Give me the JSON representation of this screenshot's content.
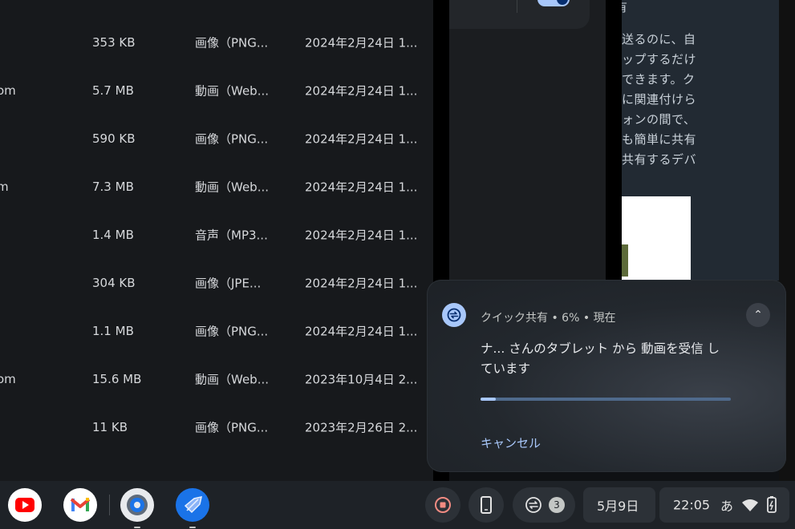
{
  "files": {
    "rows": [
      {
        "name": "",
        "size": "353 KB",
        "type": "画像（PNG...",
        "date": "2024年2月24日 1..."
      },
      {
        "name": "om",
        "size": "5.7 MB",
        "type": "動画（Web...",
        "date": "2024年2月24日 1..."
      },
      {
        "name": "",
        "size": "590 KB",
        "type": "画像（PNG...",
        "date": "2024年2月24日 1..."
      },
      {
        "name": "m",
        "size": "7.3 MB",
        "type": "動画（Web...",
        "date": "2024年2月24日 1..."
      },
      {
        "name": "",
        "size": "1.4 MB",
        "type": "音声（MP3...",
        "date": "2024年2月24日 1..."
      },
      {
        "name": "",
        "size": "304 KB",
        "type": "画像（JPE...",
        "date": "2024年2月24日 1..."
      },
      {
        "name": "",
        "size": "1.1 MB",
        "type": "画像（PNG...",
        "date": "2024年2月24日 1..."
      },
      {
        "name": "om",
        "size": "15.6 MB",
        "type": "動画（Web...",
        "date": "2023年10月4日 2..."
      },
      {
        "name": "",
        "size": "11 KB",
        "type": "画像（PNG...",
        "date": "2023年2月26日 2..."
      }
    ]
  },
  "help": {
    "heading": "有",
    "lines": [
      "送るのに、自",
      "ップするだけ",
      "できます。ク",
      "に関連付けら",
      "ォンの間で、",
      "も簡単に共有",
      "共有するデバ"
    ]
  },
  "notification": {
    "app": "クイック共有",
    "percent": "6%",
    "time": "現在",
    "message": "ナ... さんのタブレット から 動画を受信 しています",
    "progress": 0.06,
    "cancel_label": "キャンセル"
  },
  "shelf": {
    "apps": [
      "youtube",
      "gmail",
      "settings",
      "launcher"
    ],
    "nearby_count": "3",
    "date": "5月9日",
    "time": "22:05",
    "ime": "あ"
  },
  "colors": {
    "accent": "#a8c7fa",
    "youtube": "#ff0000",
    "shelf": "#1e2227"
  }
}
